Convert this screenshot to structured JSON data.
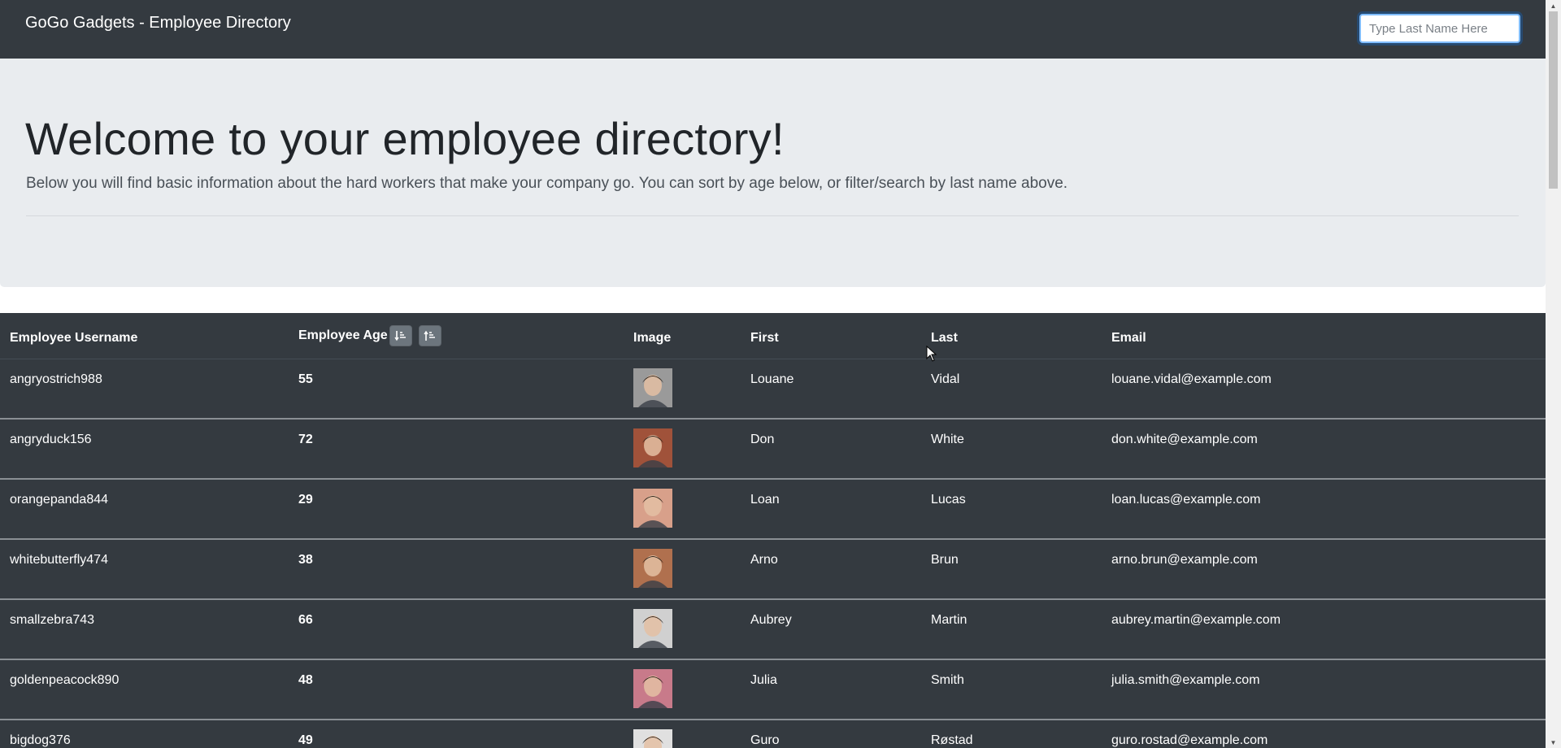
{
  "navbar": {
    "brand": "GoGo Gadgets - Employee Directory",
    "search_placeholder": "Type Last Name Here"
  },
  "jumbotron": {
    "title": "Welcome to your employee directory!",
    "lead": "Below you will find basic information about the hard workers that make your company go. You can sort by age below, or filter/search by last name above."
  },
  "table": {
    "headers": {
      "username": "Employee Username",
      "age": "Employee Age",
      "image": "Image",
      "first": "First",
      "last": "Last",
      "email": "Email"
    },
    "sort_buttons": [
      "sort-ascending-icon",
      "sort-descending-icon"
    ],
    "rows": [
      {
        "username": "angryostrich988",
        "age": "55",
        "first": "Louane",
        "last": "Vidal",
        "email": "louane.vidal@example.com",
        "photo_tone": "#9a9a9a"
      },
      {
        "username": "angryduck156",
        "age": "72",
        "first": "Don",
        "last": "White",
        "email": "don.white@example.com",
        "photo_tone": "#a0523a"
      },
      {
        "username": "orangepanda844",
        "age": "29",
        "first": "Loan",
        "last": "Lucas",
        "email": "loan.lucas@example.com",
        "photo_tone": "#d8a08a"
      },
      {
        "username": "whitebutterfly474",
        "age": "38",
        "first": "Arno",
        "last": "Brun",
        "email": "arno.brun@example.com",
        "photo_tone": "#b0704e"
      },
      {
        "username": "smallzebra743",
        "age": "66",
        "first": "Aubrey",
        "last": "Martin",
        "email": "aubrey.martin@example.com",
        "photo_tone": "#d0d0d0"
      },
      {
        "username": "goldenpeacock890",
        "age": "48",
        "first": "Julia",
        "last": "Smith",
        "email": "julia.smith@example.com",
        "photo_tone": "#c87a8a"
      },
      {
        "username": "bigdog376",
        "age": "49",
        "first": "Guro",
        "last": "Røstad",
        "email": "guro.rostad@example.com",
        "photo_tone": "#e0e0e0"
      }
    ]
  },
  "colors": {
    "navbar_bg": "#343a40",
    "jumbotron_bg": "#e9ecef",
    "table_bg": "#343a40",
    "sort_button_bg": "#6c757d"
  }
}
